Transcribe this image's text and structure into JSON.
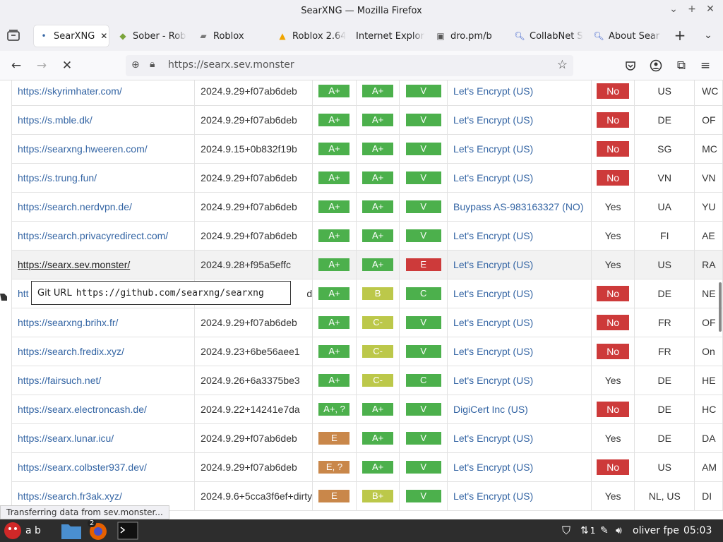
{
  "window": {
    "title": "SearXNG — Mozilla Firefox"
  },
  "tabs": [
    {
      "label": "SearXNG",
      "icon": "dot-icon",
      "active": true
    },
    {
      "label": "Sober - Rob",
      "icon": "sober-icon"
    },
    {
      "label": "Roblox",
      "icon": "roblox-icon"
    },
    {
      "label": "Roblox 2.64",
      "icon": "warning-icon"
    },
    {
      "label": "Internet Explor",
      "icon": ""
    },
    {
      "label": "dro.pm/b",
      "icon": "page-icon"
    },
    {
      "label": "CollabNet S",
      "icon": "search-icon"
    },
    {
      "label": "About Sear",
      "icon": "search-icon"
    }
  ],
  "nav": {
    "url": "https://searx.sev.monster"
  },
  "rows": [
    {
      "url": "https://skyrimhater.com/",
      "version": "2024.9.29+f07ab6deb",
      "g1": "A+",
      "g2": "A+",
      "g3": "V",
      "ca": "Let's Encrypt (US)",
      "ipv6": "No",
      "country": "US",
      "last": "WC"
    },
    {
      "url": "https://s.mble.dk/",
      "version": "2024.9.29+f07ab6deb",
      "g1": "A+",
      "g2": "A+",
      "g3": "V",
      "ca": "Let's Encrypt (US)",
      "ipv6": "No",
      "country": "DE",
      "last": "OF"
    },
    {
      "url": "https://searxng.hweeren.com/",
      "version": "2024.9.15+0b832f19b",
      "g1": "A+",
      "g2": "A+",
      "g3": "V",
      "ca": "Let's Encrypt (US)",
      "ipv6": "No",
      "country": "SG",
      "last": "MC"
    },
    {
      "url": "https://s.trung.fun/",
      "version": "2024.9.29+f07ab6deb",
      "g1": "A+",
      "g2": "A+",
      "g3": "V",
      "ca": "Let's Encrypt (US)",
      "ipv6": "No",
      "country": "VN",
      "last": "VN"
    },
    {
      "url": "https://search.nerdvpn.de/",
      "version": "2024.9.29+f07ab6deb",
      "g1": "A+",
      "g2": "A+",
      "g3": "V",
      "ca": "Buypass AS-983163327 (NO)",
      "ipv6": "Yes",
      "country": "UA",
      "last": "YU"
    },
    {
      "url": "https://search.privacyredirect.com/",
      "version": "2024.9.29+f07ab6deb",
      "g1": "A+",
      "g2": "A+",
      "g3": "V",
      "ca": "Let's Encrypt (US)",
      "ipv6": "Yes",
      "country": "FI",
      "last": "AE"
    },
    {
      "url": "https://searx.sev.monster/",
      "version": "2024.9.28+f95a5effc",
      "g1": "A+",
      "g2": "A+",
      "g3": "E",
      "ca": "Let's Encrypt (US)",
      "ipv6": "Yes",
      "country": "US",
      "last": "RA"
    },
    {
      "url": "htt",
      "version": "d",
      "g1": "A+",
      "g2": "B",
      "g3": "C",
      "ca": "Let's Encrypt (US)",
      "ipv6": "No",
      "country": "DE",
      "last": "NE"
    },
    {
      "url": "https://searxng.brihx.fr/",
      "version": "2024.9.29+f07ab6deb",
      "g1": "A+",
      "g2": "C-",
      "g3": "V",
      "ca": "Let's Encrypt (US)",
      "ipv6": "No",
      "country": "FR",
      "last": "OF"
    },
    {
      "url": "https://search.fredix.xyz/",
      "version": "2024.9.23+6be56aee1",
      "g1": "A+",
      "g2": "C-",
      "g3": "V",
      "ca": "Let's Encrypt (US)",
      "ipv6": "No",
      "country": "FR",
      "last": "On"
    },
    {
      "url": "https://fairsuch.net/",
      "version": "2024.9.26+6a3375be3",
      "g1": "A+",
      "g2": "C-",
      "g3": "C",
      "ca": "Let's Encrypt (US)",
      "ipv6": "Yes",
      "country": "DE",
      "last": "HE"
    },
    {
      "url": "https://searx.electroncash.de/",
      "version": "2024.9.22+14241e7da",
      "g1": "A+, ?",
      "g2": "A+",
      "g3": "V",
      "ca": "DigiCert Inc (US)",
      "ipv6": "No",
      "country": "DE",
      "last": "HC"
    },
    {
      "url": "https://searx.lunar.icu/",
      "version": "2024.9.29+f07ab6deb",
      "g1": "E",
      "g2": "A+",
      "g3": "V",
      "ca": "Let's Encrypt (US)",
      "ipv6": "Yes",
      "country": "DE",
      "last": "DA"
    },
    {
      "url": "https://searx.colbster937.dev/",
      "version": "2024.9.29+f07ab6deb",
      "g1": "E, ?",
      "g2": "A+",
      "g3": "V",
      "ca": "Let's Encrypt (US)",
      "ipv6": "No",
      "country": "US",
      "last": "AM"
    },
    {
      "url": "https://search.fr3ak.xyz/",
      "version": "2024.9.6+5cca3f6ef+dirty",
      "g1": "E",
      "g2": "B+",
      "g3": "V",
      "ca": "Let's Encrypt (US)",
      "ipv6": "Yes",
      "country": "NL, US",
      "last": "DI"
    }
  ],
  "tooltip": {
    "label": "Git URL",
    "value": "https://github.com/searxng/searxng"
  },
  "status": "Transferring data from sev.monster...",
  "taskbar": {
    "workspace": "a b",
    "badge": "2",
    "user": "oliver fpe",
    "time": "05:03",
    "net": "1"
  },
  "colors": {
    "green": "#4cb04c",
    "lime": "#bcc84a",
    "orange": "#c9874a",
    "red": "#cd3a3a"
  }
}
